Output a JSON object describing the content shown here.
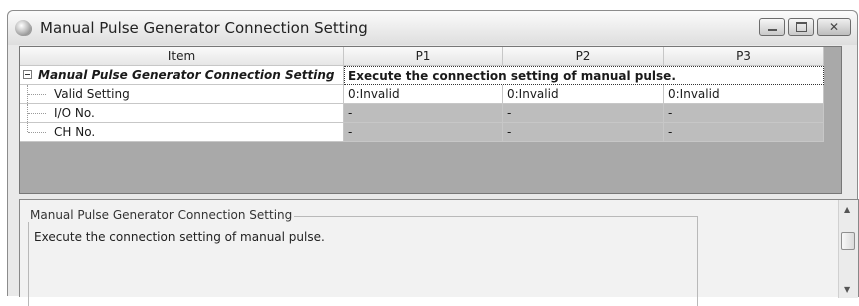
{
  "window": {
    "title": "Manual Pulse Generator Connection Setting",
    "icon": "gear-disc-icon",
    "controls": [
      "minimize-icon",
      "maximize-icon",
      "close-icon"
    ]
  },
  "grid": {
    "headers": {
      "item": "Item",
      "p1": "P1",
      "p2": "P2",
      "p3": "P3"
    },
    "section": {
      "label": "Manual Pulse Generator Connection Setting",
      "description": "Execute the connection setting of manual pulse."
    },
    "rows": [
      {
        "label": "Valid Setting",
        "p1": "0:Invalid",
        "p2": "0:Invalid",
        "p3": "0:Invalid"
      },
      {
        "label": "I/O No.",
        "p1": "-",
        "p2": "-",
        "p3": "-"
      },
      {
        "label": "CH No.",
        "p1": "-",
        "p2": "-",
        "p3": "-"
      }
    ]
  },
  "description_panel": {
    "title": "Manual Pulse Generator Connection Setting",
    "text": "Execute the connection setting of manual pulse."
  },
  "colors": {
    "grid_background": "#a9a9a9",
    "disabled_cell": "#bdbdbd",
    "panel_background": "#f2f2f2"
  }
}
